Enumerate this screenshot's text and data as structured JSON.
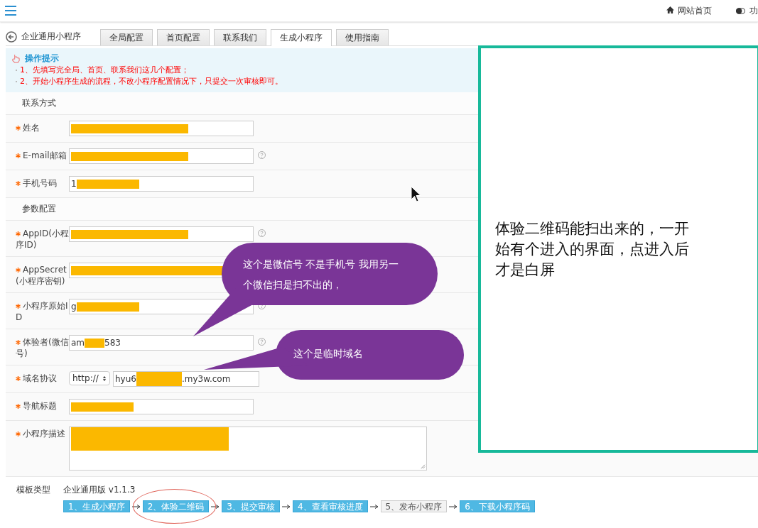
{
  "top_bar": {
    "home_link": "网站首页",
    "cut_item": "功"
  },
  "page_title": "企业通用小程序",
  "tabs": [
    {
      "label": "全局配置",
      "selected": false
    },
    {
      "label": "首页配置",
      "selected": false
    },
    {
      "label": "联系我们",
      "selected": false
    },
    {
      "label": "生成小程序",
      "selected": true
    },
    {
      "label": "使用指南",
      "selected": false
    }
  ],
  "tips": {
    "title": "操作提示",
    "items": [
      "1、先填写完全局、首页、联系我们这几个配置；",
      "2、开始小程序生成的流程，不改小程序配置情况下，只提交一次审核即可。"
    ]
  },
  "sections": [
    {
      "title": "联系方式",
      "fields": [
        {
          "label": "姓名",
          "required": true,
          "kind": "text",
          "help": false,
          "segments": [
            {
              "kind": "redaction"
            }
          ]
        },
        {
          "label": "E-mail邮箱",
          "required": true,
          "kind": "text",
          "help": true,
          "segments": [
            {
              "kind": "redaction"
            }
          ]
        },
        {
          "label": "手机号码",
          "required": true,
          "kind": "text",
          "help": false,
          "segments": [
            {
              "kind": "text",
              "text": "1"
            },
            {
              "kind": "redaction"
            }
          ]
        }
      ]
    },
    {
      "title": "参数配置",
      "fields": [
        {
          "label": "AppID(小程序ID)",
          "required": true,
          "kind": "text",
          "help": true,
          "segments": [
            {
              "kind": "redaction"
            }
          ]
        },
        {
          "label": "AppSecret(小程序密钥)",
          "required": true,
          "kind": "text",
          "help": false,
          "segments": [
            {
              "kind": "redaction"
            }
          ]
        },
        {
          "label": "小程序原始ID",
          "required": true,
          "kind": "text",
          "help": true,
          "segments": [
            {
              "kind": "text",
              "text": "g"
            },
            {
              "kind": "redaction"
            }
          ]
        },
        {
          "label": "体验者(微信号)",
          "required": true,
          "kind": "text",
          "help": true,
          "segments": [
            {
              "kind": "text",
              "text": "am"
            },
            {
              "kind": "redaction"
            },
            {
              "kind": "text",
              "text": "583"
            }
          ]
        },
        {
          "label": "域名协议",
          "required": true,
          "kind": "select_text",
          "select": "http://",
          "help": false,
          "segments": [
            {
              "kind": "text",
              "text": "hyu6"
            },
            {
              "kind": "redaction"
            },
            {
              "kind": "text",
              "text": ".my3w.com"
            }
          ]
        },
        {
          "label": "导航标题",
          "required": true,
          "kind": "text",
          "help": false,
          "segments": [
            {
              "kind": "redaction"
            }
          ]
        },
        {
          "label": "小程序描述",
          "required": true,
          "kind": "textarea",
          "help": false,
          "segments": [
            {
              "kind": "redaction"
            }
          ]
        }
      ]
    }
  ],
  "template": {
    "label": "模板类型",
    "value": "企业通用版 v1.1.3"
  },
  "steps": [
    {
      "label": "1、生成小程序",
      "enabled": true,
      "circled": false
    },
    {
      "label": "2、体验二维码",
      "enabled": true,
      "circled": true
    },
    {
      "label": "3、提交审核",
      "enabled": true,
      "circled": false
    },
    {
      "label": "4、查看审核进度",
      "enabled": true,
      "circled": false
    },
    {
      "label": "5、发布小程序",
      "enabled": false,
      "circled": false
    },
    {
      "label": "6、下载小程序码",
      "enabled": true,
      "circled": false
    }
  ],
  "annotations": {
    "bubbles": [
      "这个是微信号 不是手机号 我用另一个微信扫是扫不出的，",
      "这个是临时域名"
    ],
    "note": "体验二维码能扫出来的，一开始有个进入的界面，点进入后才是白屏"
  }
}
